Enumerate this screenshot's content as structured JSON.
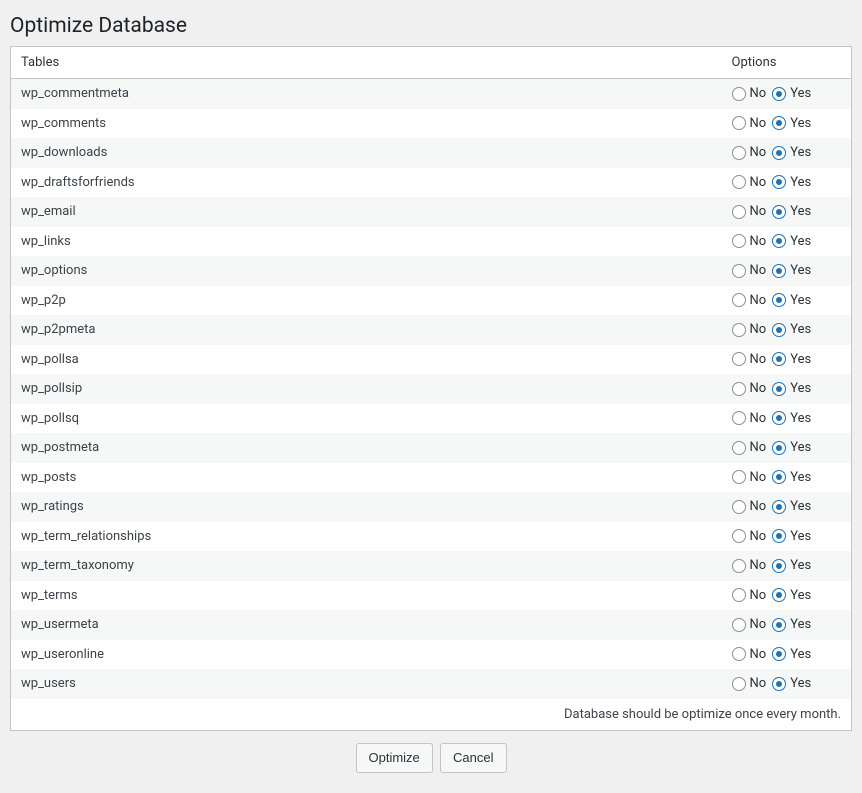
{
  "page": {
    "title": "Optimize Database",
    "footer_note": "Database should be optimize once every month.",
    "optimize_label": "Optimize",
    "cancel_label": "Cancel"
  },
  "headers": {
    "tables": "Tables",
    "options": "Options"
  },
  "labels": {
    "no": "No",
    "yes": "Yes"
  },
  "rows": [
    {
      "name": "wp_commentmeta",
      "selected": "yes"
    },
    {
      "name": "wp_comments",
      "selected": "yes"
    },
    {
      "name": "wp_downloads",
      "selected": "yes"
    },
    {
      "name": "wp_draftsforfriends",
      "selected": "yes"
    },
    {
      "name": "wp_email",
      "selected": "yes"
    },
    {
      "name": "wp_links",
      "selected": "yes"
    },
    {
      "name": "wp_options",
      "selected": "yes"
    },
    {
      "name": "wp_p2p",
      "selected": "yes"
    },
    {
      "name": "wp_p2pmeta",
      "selected": "yes"
    },
    {
      "name": "wp_pollsa",
      "selected": "yes"
    },
    {
      "name": "wp_pollsip",
      "selected": "yes"
    },
    {
      "name": "wp_pollsq",
      "selected": "yes"
    },
    {
      "name": "wp_postmeta",
      "selected": "yes"
    },
    {
      "name": "wp_posts",
      "selected": "yes"
    },
    {
      "name": "wp_ratings",
      "selected": "yes"
    },
    {
      "name": "wp_term_relationships",
      "selected": "yes"
    },
    {
      "name": "wp_term_taxonomy",
      "selected": "yes"
    },
    {
      "name": "wp_terms",
      "selected": "yes"
    },
    {
      "name": "wp_usermeta",
      "selected": "yes"
    },
    {
      "name": "wp_useronline",
      "selected": "yes"
    },
    {
      "name": "wp_users",
      "selected": "yes"
    }
  ]
}
